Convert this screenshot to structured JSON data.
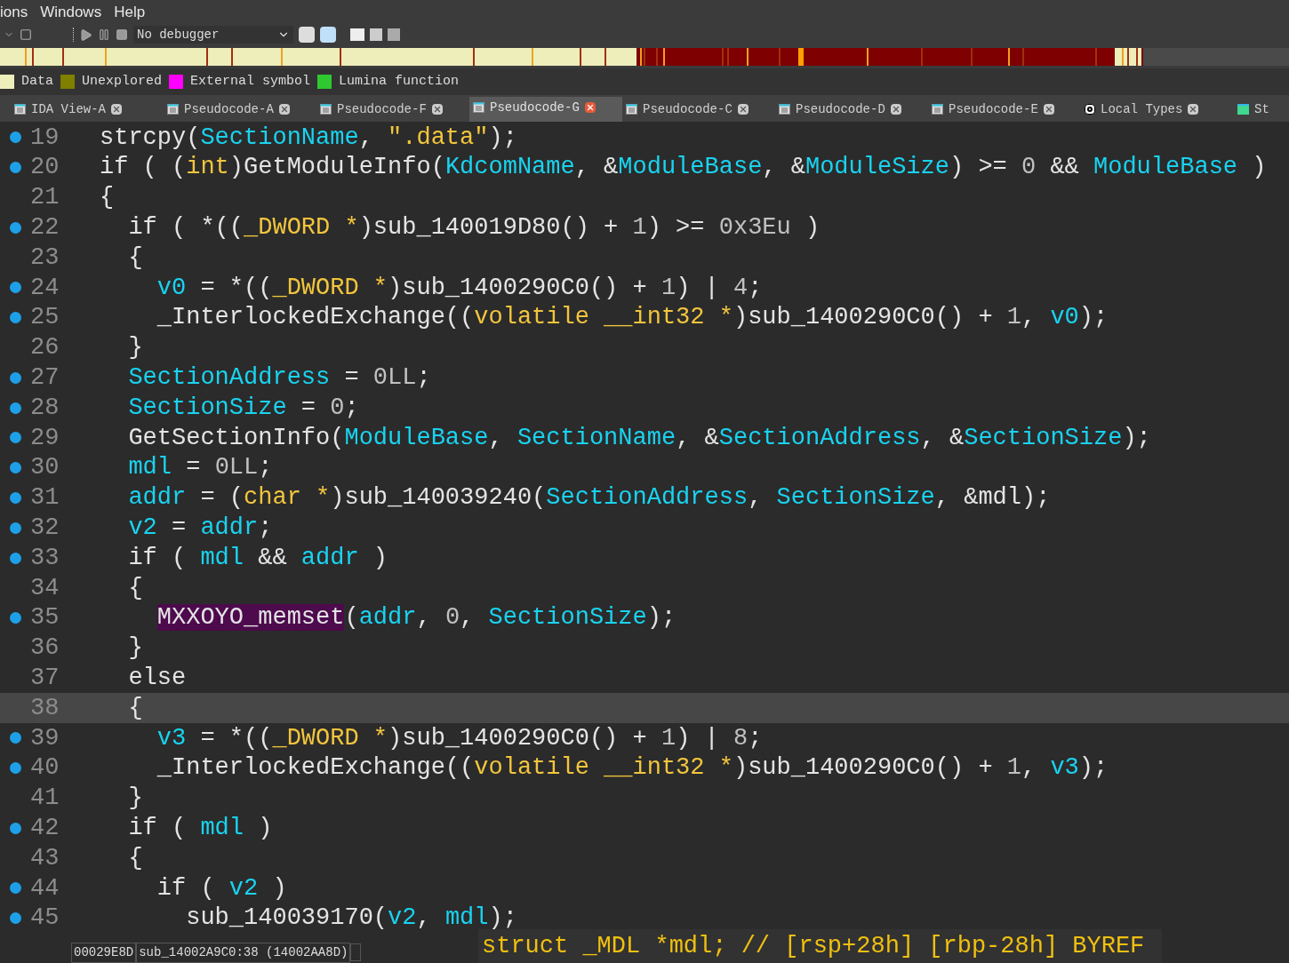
{
  "menu": [
    {
      "label": "ions"
    },
    {
      "label": "Windows"
    },
    {
      "label": "Help"
    }
  ],
  "toolbar": {
    "debugger": "No debugger"
  },
  "legend": [
    {
      "label": "Data",
      "color": "#eeeebb"
    },
    {
      "label": "Unexplored",
      "color": "#7f7f00"
    },
    {
      "label": "External symbol",
      "color": "#ff00ff"
    },
    {
      "label": "Lumina function",
      "color": "#30c830"
    }
  ],
  "tabs": [
    {
      "label": "IDA View-A",
      "selected": false,
      "kind": "table"
    },
    {
      "label": "Pseudocode-A",
      "selected": false,
      "kind": "table"
    },
    {
      "label": "Pseudocode-F",
      "selected": false,
      "kind": "table"
    },
    {
      "label": "Pseudocode-G",
      "selected": true,
      "kind": "table"
    },
    {
      "label": "Pseudocode-C",
      "selected": false,
      "kind": "table"
    },
    {
      "label": "Pseudocode-D",
      "selected": false,
      "kind": "table"
    },
    {
      "label": "Pseudocode-E",
      "selected": false,
      "kind": "table"
    },
    {
      "label": "Local Types",
      "selected": false,
      "kind": "types"
    },
    {
      "label": "St",
      "selected": false,
      "kind": "strings"
    }
  ],
  "code": [
    {
      "n": "19",
      "bp": true,
      "current": false,
      "tokens": [
        {
          "kind": "plain",
          "text": "strcpy("
        },
        {
          "kind": "variable",
          "text": "SectionName"
        },
        {
          "kind": "plain",
          "text": ", "
        },
        {
          "kind": "string",
          "text": "\".data\""
        },
        {
          "kind": "plain",
          "text": ");"
        }
      ]
    },
    {
      "n": "20",
      "bp": true,
      "current": false,
      "tokens": [
        {
          "kind": "plain",
          "text": "if ( ("
        },
        {
          "kind": "type",
          "text": "int"
        },
        {
          "kind": "plain",
          "text": ")GetModuleInfo("
        },
        {
          "kind": "variable",
          "text": "KdcomName"
        },
        {
          "kind": "plain",
          "text": ", &"
        },
        {
          "kind": "variable",
          "text": "ModuleBase"
        },
        {
          "kind": "plain",
          "text": ", &"
        },
        {
          "kind": "variable",
          "text": "ModuleSize"
        },
        {
          "kind": "plain",
          "text": ") >= "
        },
        {
          "kind": "number",
          "text": "0"
        },
        {
          "kind": "plain",
          "text": " && "
        },
        {
          "kind": "variable",
          "text": "ModuleBase"
        },
        {
          "kind": "plain",
          "text": " )"
        }
      ]
    },
    {
      "n": "21",
      "bp": false,
      "current": false,
      "tokens": [
        {
          "kind": "plain",
          "text": "{"
        }
      ]
    },
    {
      "n": "22",
      "bp": true,
      "current": false,
      "tokens": [
        {
          "kind": "plain",
          "text": "  if ( *(("
        },
        {
          "kind": "type",
          "text": "_DWORD *"
        },
        {
          "kind": "plain",
          "text": ")sub_140019D80() + "
        },
        {
          "kind": "number",
          "text": "1"
        },
        {
          "kind": "plain",
          "text": ") >= "
        },
        {
          "kind": "number",
          "text": "0x3Eu"
        },
        {
          "kind": "plain",
          "text": " )"
        }
      ]
    },
    {
      "n": "23",
      "bp": false,
      "current": false,
      "tokens": [
        {
          "kind": "plain",
          "text": "  {"
        }
      ]
    },
    {
      "n": "24",
      "bp": true,
      "current": false,
      "tokens": [
        {
          "kind": "variable",
          "text": "    v0"
        },
        {
          "kind": "plain",
          "text": " = *(("
        },
        {
          "kind": "type",
          "text": "_DWORD *"
        },
        {
          "kind": "plain",
          "text": ")sub_1400290C0() + "
        },
        {
          "kind": "number",
          "text": "1"
        },
        {
          "kind": "plain",
          "text": ") | "
        },
        {
          "kind": "number",
          "text": "4"
        },
        {
          "kind": "plain",
          "text": ";"
        }
      ]
    },
    {
      "n": "25",
      "bp": true,
      "current": false,
      "tokens": [
        {
          "kind": "plain",
          "text": "    _InterlockedExchange(("
        },
        {
          "kind": "type",
          "text": "volatile __int32 *"
        },
        {
          "kind": "plain",
          "text": ")sub_1400290C0() + "
        },
        {
          "kind": "number",
          "text": "1"
        },
        {
          "kind": "plain",
          "text": ", "
        },
        {
          "kind": "variable",
          "text": "v0"
        },
        {
          "kind": "plain",
          "text": ");"
        }
      ]
    },
    {
      "n": "26",
      "bp": false,
      "current": false,
      "tokens": [
        {
          "kind": "plain",
          "text": "  }"
        }
      ]
    },
    {
      "n": "27",
      "bp": true,
      "current": false,
      "tokens": [
        {
          "kind": "variable",
          "text": "  SectionAddress"
        },
        {
          "kind": "plain",
          "text": " = "
        },
        {
          "kind": "number",
          "text": "0LL"
        },
        {
          "kind": "plain",
          "text": ";"
        }
      ]
    },
    {
      "n": "28",
      "bp": true,
      "current": false,
      "tokens": [
        {
          "kind": "variable",
          "text": "  SectionSize"
        },
        {
          "kind": "plain",
          "text": " = "
        },
        {
          "kind": "number",
          "text": "0"
        },
        {
          "kind": "plain",
          "text": ";"
        }
      ]
    },
    {
      "n": "29",
      "bp": true,
      "current": false,
      "tokens": [
        {
          "kind": "plain",
          "text": "  GetSectionInfo("
        },
        {
          "kind": "variable",
          "text": "ModuleBase"
        },
        {
          "kind": "plain",
          "text": ", "
        },
        {
          "kind": "variable",
          "text": "SectionName"
        },
        {
          "kind": "plain",
          "text": ", &"
        },
        {
          "kind": "variable",
          "text": "SectionAddress"
        },
        {
          "kind": "plain",
          "text": ", &"
        },
        {
          "kind": "variable",
          "text": "SectionSize"
        },
        {
          "kind": "plain",
          "text": ");"
        }
      ]
    },
    {
      "n": "30",
      "bp": true,
      "current": false,
      "tokens": [
        {
          "kind": "variable",
          "text": "  mdl"
        },
        {
          "kind": "plain",
          "text": " = "
        },
        {
          "kind": "number",
          "text": "0LL"
        },
        {
          "kind": "plain",
          "text": ";"
        }
      ]
    },
    {
      "n": "31",
      "bp": true,
      "current": false,
      "tokens": [
        {
          "kind": "variable",
          "text": "  addr"
        },
        {
          "kind": "plain",
          "text": " = ("
        },
        {
          "kind": "type",
          "text": "char *"
        },
        {
          "kind": "plain",
          "text": ")sub_140039240("
        },
        {
          "kind": "variable",
          "text": "SectionAddress"
        },
        {
          "kind": "plain",
          "text": ", "
        },
        {
          "kind": "variable",
          "text": "SectionSize"
        },
        {
          "kind": "plain",
          "text": ", &mdl);"
        }
      ]
    },
    {
      "n": "32",
      "bp": true,
      "current": false,
      "tokens": [
        {
          "kind": "variable",
          "text": "  v2"
        },
        {
          "kind": "plain",
          "text": " = "
        },
        {
          "kind": "variable",
          "text": "addr"
        },
        {
          "kind": "plain",
          "text": ";"
        }
      ]
    },
    {
      "n": "33",
      "bp": true,
      "current": false,
      "tokens": [
        {
          "kind": "plain",
          "text": "  if ( "
        },
        {
          "kind": "variable",
          "text": "mdl"
        },
        {
          "kind": "plain",
          "text": " && "
        },
        {
          "kind": "variable",
          "text": "addr"
        },
        {
          "kind": "plain",
          "text": " )"
        }
      ]
    },
    {
      "n": "34",
      "bp": false,
      "current": false,
      "tokens": [
        {
          "kind": "plain",
          "text": "  {"
        }
      ]
    },
    {
      "n": "35",
      "bp": true,
      "current": false,
      "tokens": [
        {
          "kind": "highlight",
          "text": "    MXXOYO_memset"
        },
        {
          "kind": "plain",
          "text": "("
        },
        {
          "kind": "variable",
          "text": "addr"
        },
        {
          "kind": "plain",
          "text": ", "
        },
        {
          "kind": "number",
          "text": "0"
        },
        {
          "kind": "plain",
          "text": ", "
        },
        {
          "kind": "variable",
          "text": "SectionSize"
        },
        {
          "kind": "plain",
          "text": ");"
        }
      ]
    },
    {
      "n": "36",
      "bp": false,
      "current": false,
      "tokens": [
        {
          "kind": "plain",
          "text": "  }"
        }
      ]
    },
    {
      "n": "37",
      "bp": false,
      "current": false,
      "tokens": [
        {
          "kind": "plain",
          "text": "  else"
        }
      ]
    },
    {
      "n": "38",
      "bp": false,
      "current": true,
      "tokens": [
        {
          "kind": "plain",
          "text": "  {"
        }
      ]
    },
    {
      "n": "39",
      "bp": true,
      "current": false,
      "tokens": [
        {
          "kind": "variable",
          "text": "    v3"
        },
        {
          "kind": "plain",
          "text": " = *(("
        },
        {
          "kind": "type",
          "text": "_DWORD *"
        },
        {
          "kind": "plain",
          "text": ")sub_1400290C0() + "
        },
        {
          "kind": "number",
          "text": "1"
        },
        {
          "kind": "plain",
          "text": ") | "
        },
        {
          "kind": "number",
          "text": "8"
        },
        {
          "kind": "plain",
          "text": ";"
        }
      ]
    },
    {
      "n": "40",
      "bp": true,
      "current": false,
      "tokens": [
        {
          "kind": "plain",
          "text": "    _InterlockedExchange(("
        },
        {
          "kind": "type",
          "text": "volatile __int32 *"
        },
        {
          "kind": "plain",
          "text": ")sub_1400290C0() + "
        },
        {
          "kind": "number",
          "text": "1"
        },
        {
          "kind": "plain",
          "text": ", "
        },
        {
          "kind": "variable",
          "text": "v3"
        },
        {
          "kind": "plain",
          "text": ");"
        }
      ]
    },
    {
      "n": "41",
      "bp": false,
      "current": false,
      "tokens": [
        {
          "kind": "plain",
          "text": "  }"
        }
      ]
    },
    {
      "n": "42",
      "bp": true,
      "current": false,
      "tokens": [
        {
          "kind": "plain",
          "text": "  if ( "
        },
        {
          "kind": "variable",
          "text": "mdl"
        },
        {
          "kind": "plain",
          "text": " )"
        }
      ]
    },
    {
      "n": "43",
      "bp": false,
      "current": false,
      "tokens": [
        {
          "kind": "plain",
          "text": "  {"
        }
      ]
    },
    {
      "n": "44",
      "bp": true,
      "current": false,
      "tokens": [
        {
          "kind": "plain",
          "text": "    if ( "
        },
        {
          "kind": "variable",
          "text": "v2"
        },
        {
          "kind": "plain",
          "text": " )"
        }
      ]
    },
    {
      "n": "45",
      "bp": true,
      "current": false,
      "tokens": [
        {
          "kind": "plain",
          "text": "      sub_140039170("
        },
        {
          "kind": "variable",
          "text": "v2"
        },
        {
          "kind": "plain",
          "text": ", "
        },
        {
          "kind": "variable",
          "text": "mdl"
        },
        {
          "kind": "plain",
          "text": ");"
        }
      ]
    }
  ],
  "hint": "struct _MDL *mdl; // [rsp+28h] [rbp-28h] BYREF",
  "status_bar": [
    {
      "text": "00029E8D"
    },
    {
      "text": "sub_14002A9C0:38 (14002AA8D)"
    }
  ]
}
